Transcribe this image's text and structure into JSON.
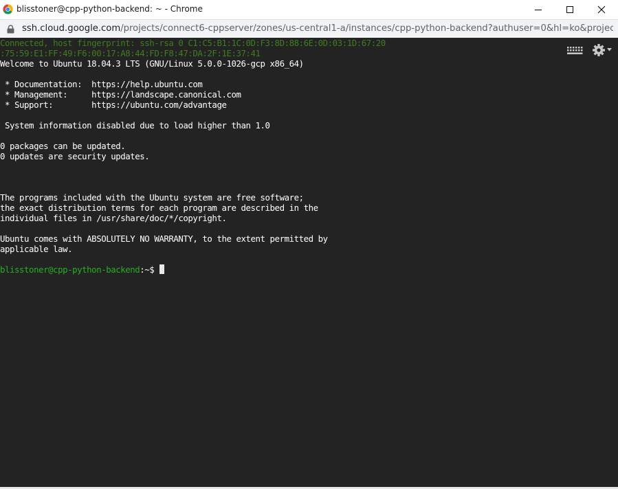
{
  "window": {
    "title": "blisstoner@cpp-python-backend: ~ - Chrome"
  },
  "address_bar": {
    "host": "ssh.cloud.google.com",
    "path": "/projects/connect6-cppserver/zones/us-central1-a/instances/cpp-python-backend?authuser=0&hl=ko&projec..."
  },
  "terminal": {
    "lines": [
      "Connected, host fingerprint: ssh-rsa 0 C1:C5:B1:1C:0D:F3:8D:88:6E:0D:03:1D:67:20",
      ":75:59:E1:FF:49:F6:00:17:A8:44:FD:F8:47:DA:2F:1E:37:41",
      "Welcome to Ubuntu 18.04.3 LTS (GNU/Linux 5.0.0-1026-gcp x86_64)",
      "",
      " * Documentation:  https://help.ubuntu.com",
      " * Management:     https://landscape.canonical.com",
      " * Support:        https://ubuntu.com/advantage",
      "",
      " System information disabled due to load higher than 1.0",
      "",
      "0 packages can be updated.",
      "0 updates are security updates.",
      "",
      "",
      "",
      "The programs included with the Ubuntu system are free software;",
      "the exact distribution terms for each program are described in the",
      "individual files in /usr/share/doc/*/copyright.",
      "",
      "Ubuntu comes with ABSOLUTELY NO WARRANTY, to the extent permitted by",
      "applicable law.",
      ""
    ],
    "prompt": {
      "user_host": "blisstoner@cpp-python-backend",
      "path": ":~$ "
    }
  },
  "colors": {
    "terminal_bg": "#232323",
    "terminal_fg": "#ffffff",
    "dim_green": "#3f7d1e",
    "prompt_green": "#26b01e"
  },
  "icons": {
    "browser": "chrome-logo-icon",
    "lock": "lock-icon",
    "keyboard": "keyboard-icon",
    "settings": "gear-icon"
  }
}
